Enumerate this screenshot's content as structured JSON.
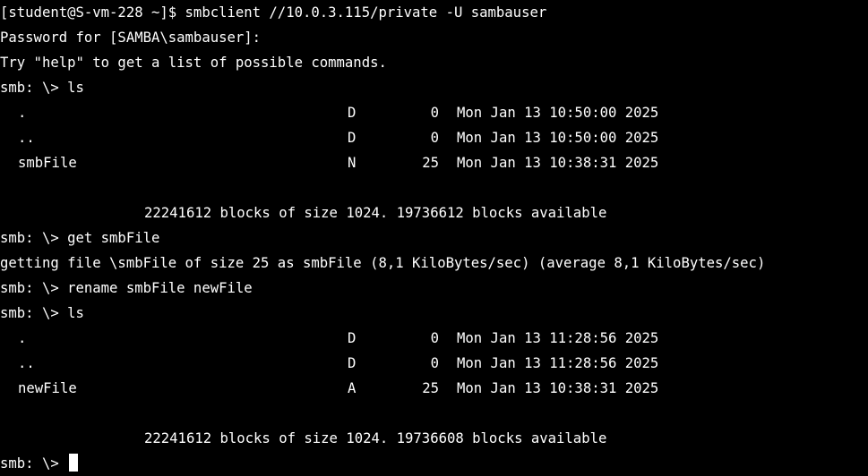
{
  "terminal": {
    "lines": {
      "l0": "[student@S-vm-228 ~]$ smbclient //10.0.3.115/private -U sambauser",
      "l1": "Password for [SAMBA\\sambauser]:",
      "l2": "Try \"help\" to get a list of possible commands.",
      "l3": "smb: \\> ls",
      "l7": "22241612 blocks of size 1024. 19736612 blocks available",
      "l8": "smb: \\> get smbFile",
      "l9": "getting file \\smbFile of size 25 as smbFile (8,1 KiloBytes/sec) (average 8,1 KiloBytes/sec)",
      "l10": "smb: \\> rename smbFile newFile",
      "l11": "smb: \\> ls",
      "l15": "22241612 blocks of size 1024. 19736608 blocks available",
      "prompt": "smb: \\>"
    },
    "listing1": [
      {
        "name": ".",
        "attr": "D",
        "size": "0",
        "date": "Mon Jan 13 10:50:00 2025"
      },
      {
        "name": "..",
        "attr": "D",
        "size": "0",
        "date": "Mon Jan 13 10:50:00 2025"
      },
      {
        "name": "smbFile",
        "attr": "N",
        "size": "25",
        "date": "Mon Jan 13 10:38:31 2025"
      }
    ],
    "listing2": [
      {
        "name": ".",
        "attr": "D",
        "size": "0",
        "date": "Mon Jan 13 11:28:56 2025"
      },
      {
        "name": "..",
        "attr": "D",
        "size": "0",
        "date": "Mon Jan 13 11:28:56 2025"
      },
      {
        "name": "newFile",
        "attr": "A",
        "size": "25",
        "date": "Mon Jan 13 10:38:31 2025"
      }
    ]
  }
}
